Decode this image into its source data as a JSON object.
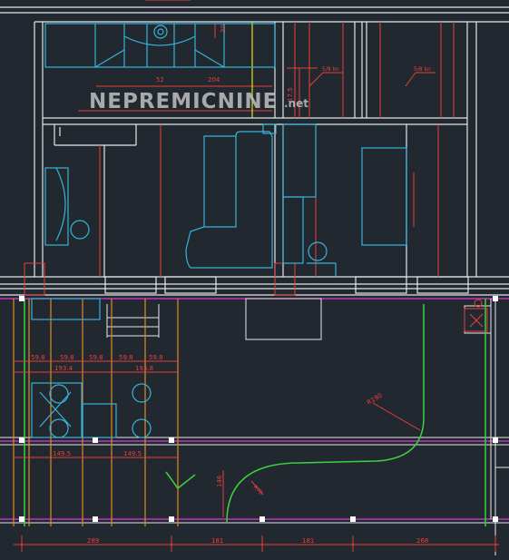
{
  "watermark": {
    "main": "NEPREMICNINE",
    "suffix": ".net"
  },
  "dimensions": {
    "top": {
      "d52": "52",
      "d204": "204",
      "d30": "30",
      "d175": "17.5",
      "s1": "5/8 kn",
      "s2": "5/8 kn"
    },
    "grid": {
      "c1": "59.8",
      "c2": "59.8",
      "c3": "59.8",
      "c4": "59.8",
      "c5": "59.8",
      "w1": "193.4",
      "w2": "193.8",
      "b1": "149.5",
      "b2": "149.5"
    },
    "radius": {
      "r_large": "R190",
      "r_small": "R70"
    },
    "vertical": {
      "v146": "146"
    },
    "bottom": {
      "d1": "289",
      "d2": "181",
      "d3": "181",
      "d4": "268"
    }
  },
  "colors": {
    "background": "#212830",
    "wall": "#e6e6e6",
    "furniture": "#36b4d8",
    "dimension": "#e8403a",
    "green": "#3bd23b",
    "magenta": "#d93ad9",
    "orange": "#e08a1e",
    "yellow": "#e8e020"
  }
}
